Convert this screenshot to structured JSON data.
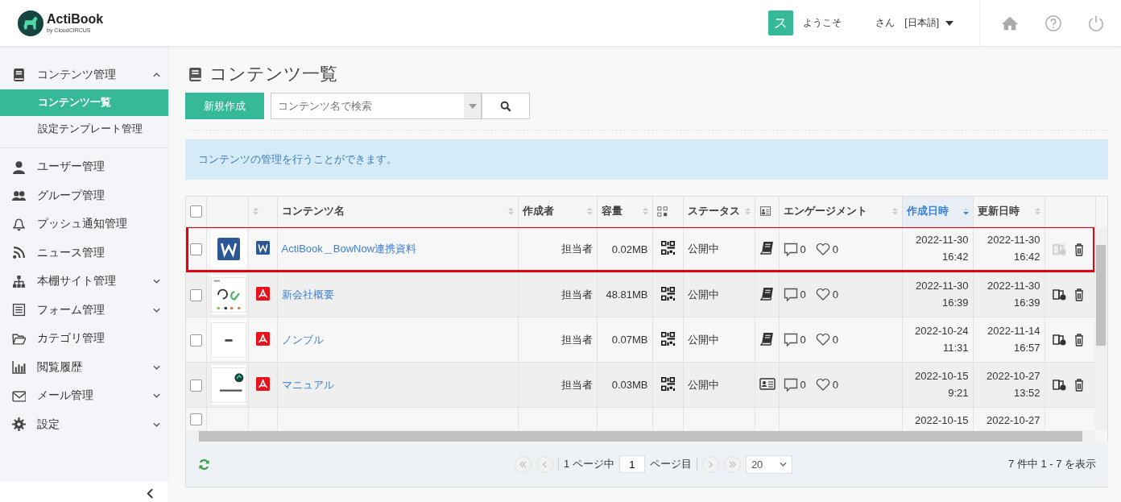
{
  "header": {
    "logo": {
      "name": "ActiBook",
      "tagline": "by CloudCIRCUS"
    },
    "avatar": "ス",
    "welcome": "ようこそ",
    "honorific": "さん",
    "language": "[日本語]"
  },
  "sidebar": {
    "items": [
      {
        "label": "コンテンツ管理",
        "expandable": true,
        "expanded": true,
        "children": [
          {
            "label": "コンテンツ一覧",
            "selected": true
          },
          {
            "label": "設定テンプレート管理",
            "selected": false
          }
        ]
      },
      {
        "label": "ユーザー管理",
        "expandable": false,
        "expanded": false
      },
      {
        "label": "グループ管理",
        "expandable": false,
        "expanded": false
      },
      {
        "label": "プッシュ通知管理",
        "expandable": false,
        "expanded": false
      },
      {
        "label": "ニュース管理",
        "expandable": false,
        "expanded": false
      },
      {
        "label": "本棚サイト管理",
        "expandable": true,
        "expanded": false
      },
      {
        "label": "フォーム管理",
        "expandable": true,
        "expanded": false
      },
      {
        "label": "カテゴリ管理",
        "expandable": false,
        "expanded": false
      },
      {
        "label": "閲覧履歴",
        "expandable": true,
        "expanded": false
      },
      {
        "label": "メール管理",
        "expandable": true,
        "expanded": false
      },
      {
        "label": "設定",
        "expandable": true,
        "expanded": false
      }
    ]
  },
  "page": {
    "title": "コンテンツ一覧",
    "new_button": "新規作成",
    "search": {
      "placeholder": "コンテンツ名で検索"
    },
    "notice": "コンテンツの管理を行うことができます。"
  },
  "table": {
    "columns": [
      {
        "kind": "checkbox",
        "sortable": false,
        "sorted": false
      },
      {
        "kind": "blank",
        "sortable": false,
        "sorted": false
      },
      {
        "kind": "blank",
        "sortable": true,
        "sorted": false
      },
      {
        "kind": "text",
        "label": "コンテンツ名",
        "sortable": true,
        "sorted": false
      },
      {
        "kind": "text",
        "label": "作成者",
        "sortable": true,
        "sorted": false
      },
      {
        "kind": "text",
        "label": "容量",
        "sortable": true,
        "sorted": false
      },
      {
        "kind": "qr",
        "sortable": false,
        "sorted": false
      },
      {
        "kind": "text",
        "label": "ステータス",
        "sortable": true,
        "sorted": false
      },
      {
        "kind": "card",
        "sortable": false,
        "sorted": false
      },
      {
        "kind": "text",
        "label": "エンゲージメント",
        "sortable": true,
        "sorted": false
      },
      {
        "kind": "text",
        "label": "作成日時",
        "sortable": true,
        "sorted": true
      },
      {
        "kind": "text",
        "label": "更新日時",
        "sortable": true,
        "sorted": false
      },
      {
        "kind": "blank",
        "sortable": false,
        "sorted": false
      }
    ],
    "header_checked": false,
    "rows": [
      {
        "kind": "word",
        "checked": false,
        "highlighted": true,
        "name": "ActiBook＿BowNow連携資料",
        "author": "担当者",
        "size": "0.02MB",
        "status": "公開中",
        "view": {
          "kind": "book"
        },
        "comments": "0",
        "likes": "0",
        "created": [
          "2022-11-30",
          "16:42"
        ],
        "updated": [
          "2022-11-30",
          "16:42"
        ],
        "copy_disabled": true
      },
      {
        "kind": "pdf",
        "checked": false,
        "highlighted": false,
        "name": "新会社概要",
        "author": "担当者",
        "size": "48.81MB",
        "status": "公開中",
        "view": {
          "kind": "book"
        },
        "comments": "0",
        "likes": "0",
        "created": [
          "2022-11-30",
          "16:39"
        ],
        "updated": [
          "2022-11-30",
          "16:39"
        ],
        "copy_disabled": false
      },
      {
        "kind": "pdf",
        "checked": false,
        "highlighted": false,
        "name": "ノンブル",
        "author": "担当者",
        "size": "0.07MB",
        "status": "公開中",
        "view": {
          "kind": "book"
        },
        "comments": "0",
        "likes": "0",
        "created": [
          "2022-10-24",
          "11:31"
        ],
        "updated": [
          "2022-11-14",
          "16:57"
        ],
        "copy_disabled": false
      },
      {
        "kind": "pdf",
        "checked": false,
        "highlighted": false,
        "name": "マニュアル",
        "author": "担当者",
        "size": "0.03MB",
        "status": "公開中",
        "view": {
          "kind": "card"
        },
        "comments": "0",
        "likes": "0",
        "created": [
          "2022-10-15",
          "9:21"
        ],
        "updated": [
          "2022-10-27",
          "13:52"
        ],
        "copy_disabled": false
      },
      {
        "kind": "partial",
        "checked": false,
        "highlighted": false,
        "created": [
          "2022-10-15"
        ],
        "updated": [
          "2022-10-27"
        ]
      }
    ]
  },
  "pagination": {
    "of_pages": "1 ページ中",
    "page": "1",
    "page_suffix": "ページ目",
    "per_page": "20",
    "summary": "7 件中 1 - 7 を表示"
  }
}
